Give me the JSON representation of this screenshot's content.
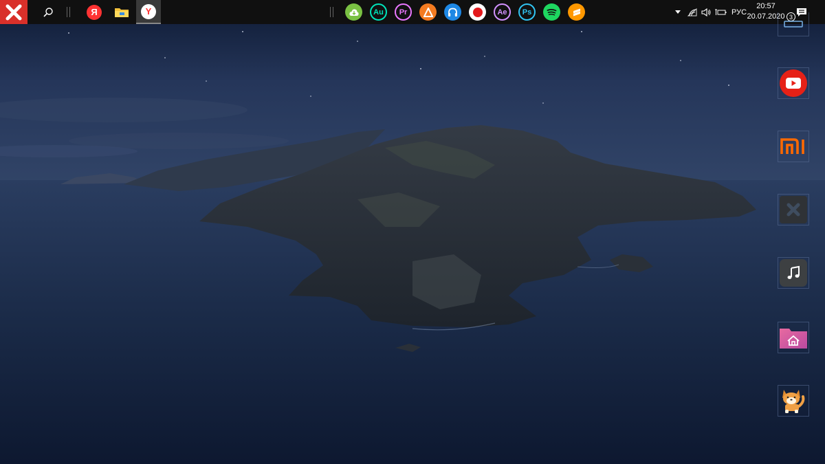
{
  "taskbar": {
    "pinned": [
      {
        "name": "Yandex",
        "label": "Я"
      },
      {
        "name": "File Explorer"
      },
      {
        "name": "Yandex Browser",
        "label": "Y"
      }
    ],
    "tray_icons": [
      {
        "label": "Au",
        "color": "#00e4bb"
      },
      {
        "label": "Pr",
        "color": "#ea77ff"
      },
      {
        "label": "Ae",
        "color": "#d291ff"
      },
      {
        "label": "Ps",
        "color": "#31c5f4"
      }
    ]
  },
  "system_tray": {
    "language": "РУС",
    "time": "20:57",
    "date": "20.07.2020",
    "notifications_count": "3"
  },
  "colors": {
    "taskbar": "#101010",
    "youtube": "#e62117",
    "xiaomi": "#ff6900",
    "spotify": "#1ed760",
    "sublime": "#ff9800"
  }
}
